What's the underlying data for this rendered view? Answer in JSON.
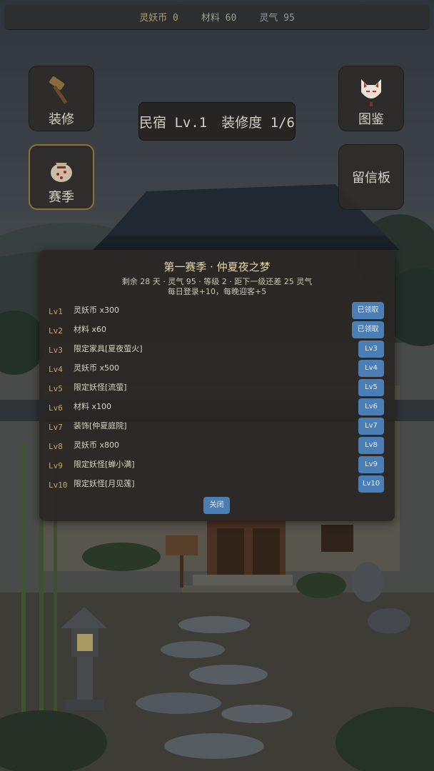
{
  "topbar": {
    "gold_label": "灵妖币 0",
    "material_label": "材料 60",
    "qi_label": "灵气 95"
  },
  "side_buttons": {
    "decorate": "装修",
    "codex": "图鉴",
    "season": "赛季",
    "message_board": "留信板"
  },
  "inn": {
    "level": "民宿 Lv.1",
    "decor": "装修度 1/6"
  },
  "season_modal": {
    "title": "第一赛季 · 仲夏夜之梦",
    "info_line1": "剩余 28 天 · 灵气 95 · 等级 2 · 距下一级还差 25 灵气",
    "info_line2": "每日登录+10，每晚迎客+5",
    "rewards": [
      {
        "level": "Lv1",
        "reward": "灵妖币 x300",
        "button": "已领取"
      },
      {
        "level": "Lv2",
        "reward": "材料 x60",
        "button": "已领取"
      },
      {
        "level": "Lv3",
        "reward": "限定家具[夏夜萤火]",
        "button": "Lv3"
      },
      {
        "level": "Lv4",
        "reward": "灵妖币 x500",
        "button": "Lv4"
      },
      {
        "level": "Lv5",
        "reward": "限定妖怪[流萤]",
        "button": "Lv5"
      },
      {
        "level": "Lv6",
        "reward": "材料 x100",
        "button": "Lv6"
      },
      {
        "level": "Lv7",
        "reward": "装饰[仲夏庭院]",
        "button": "Lv7"
      },
      {
        "level": "Lv8",
        "reward": "灵妖币 x800",
        "button": "Lv8"
      },
      {
        "level": "Lv9",
        "reward": "限定妖怪[蝉小满]",
        "button": "Lv9"
      },
      {
        "level": "Lv10",
        "reward": "限定妖怪[月见莲]",
        "button": "Lv10"
      }
    ],
    "close_label": "关闭"
  },
  "colors": {
    "accent_button": "#4a7eb5",
    "gold_text": "#c2a763",
    "title_text": "#e8d8a8"
  },
  "icons": {
    "decorate": "hammer-icon",
    "codex": "fox-mask-icon",
    "season": "pouch-icon"
  }
}
